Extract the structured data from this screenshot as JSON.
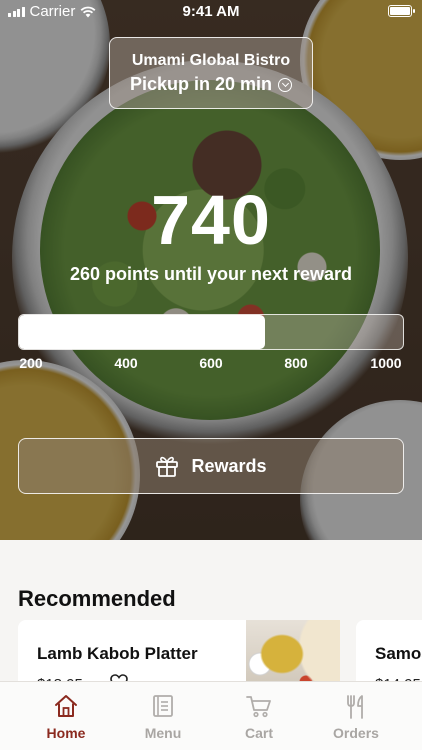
{
  "status_bar": {
    "carrier": "Carrier",
    "time": "9:41 AM"
  },
  "location": {
    "name": "Umami Global Bistro",
    "pickup": "Pickup in 20 min",
    "chevron_icon": "chevron-down-circle-icon"
  },
  "rewards": {
    "points": "740",
    "until_text": "260 points until your next reward",
    "progress_fraction": 0.64,
    "ticks": [
      "200",
      "400",
      "600",
      "800",
      "1000"
    ],
    "button_label": "Rewards",
    "button_icon": "gift-icon"
  },
  "recommended": {
    "title": "Recommended",
    "items": [
      {
        "name": "Lamb Kabob Platter",
        "price": "$18.95"
      },
      {
        "name": "Samosa",
        "price": "$14.95"
      }
    ]
  },
  "tabs": [
    {
      "label": "Home",
      "icon": "home-icon",
      "active": true
    },
    {
      "label": "Menu",
      "icon": "menu-book-icon",
      "active": false
    },
    {
      "label": "Cart",
      "icon": "cart-icon",
      "active": false
    },
    {
      "label": "Orders",
      "icon": "fork-knife-icon",
      "active": false
    }
  ],
  "colors": {
    "accent": "#8b2a1f",
    "inactive": "#a9a6a3"
  }
}
